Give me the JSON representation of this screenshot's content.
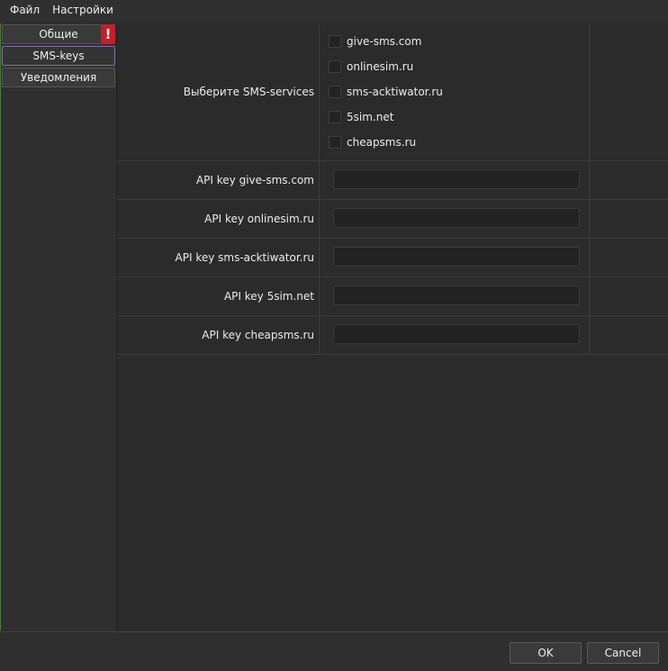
{
  "menubar": {
    "items": [
      {
        "label": "Файл"
      },
      {
        "label": "Настройки"
      }
    ]
  },
  "sidebar": {
    "items": [
      {
        "label": "Общие",
        "badge": "!"
      },
      {
        "label": "SMS-keys"
      },
      {
        "label": "Уведомления"
      }
    ],
    "active_item": "SMS-keys"
  },
  "services": {
    "label": "Выберите SMS-services",
    "options": [
      {
        "label": "give-sms.com",
        "checked": false
      },
      {
        "label": "onlinesim.ru",
        "checked": false
      },
      {
        "label": "sms-acktiwator.ru",
        "checked": false
      },
      {
        "label": "5sim.net",
        "checked": false
      },
      {
        "label": "cheapsms.ru",
        "checked": false
      }
    ]
  },
  "api_keys": [
    {
      "label": "API key give-sms.com",
      "value": ""
    },
    {
      "label": "API key onlinesim.ru",
      "value": ""
    },
    {
      "label": "API key sms-acktiwator.ru",
      "value": ""
    },
    {
      "label": "API key 5sim.net",
      "value": ""
    },
    {
      "label": "API key cheapsms.ru",
      "value": ""
    }
  ],
  "footer": {
    "ok_label": "OK",
    "cancel_label": "Cancel"
  },
  "colors": {
    "background": "#2e2e2e",
    "active_border": "#8c6bb1",
    "warning_badge": "#c0202a",
    "input_background": "#232323"
  }
}
